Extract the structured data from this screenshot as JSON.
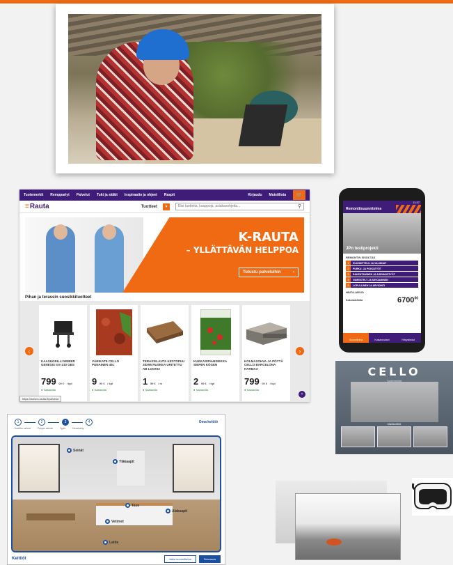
{
  "site": {
    "nav": [
      "Tuotemerkit",
      "Remppariyt",
      "Palvelut",
      "Tukt ja säläit",
      "Inspiraatio ja ohjeet",
      "Raspit"
    ],
    "nav_right": [
      "Kirjaudu",
      "Muistilista"
    ],
    "logo": "Rauta",
    "products_label": "Tuotteet",
    "search_placeholder": "Etsi tuotteita, kauppoja, asiakasohjeita...",
    "hero_title": "K-RAUTA",
    "hero_subtitle": "– YLLÄTTÄVÄN HELPPOA",
    "hero_button": "Tutustu palveluihin",
    "section_title": "Pihan ja terassin suosikkituotteet",
    "status_url": "https://www.k-rauta.fi/palvelut",
    "products": [
      {
        "name": "KAASUGRILLI WEBER GENESIS II E-210 GBS",
        "price": "799",
        "cents": "00 €",
        "unit": "/ kpl",
        "stock": "Saatavilla"
      },
      {
        "name": "VÄRIKATE CELLO PUNAINEN 45L",
        "price": "9",
        "cents": "90 €",
        "unit": "/ kpl",
        "stock": "Saatavilla"
      },
      {
        "name": "TERASSILAUTA KESTOPUU 28X95 RUSKEA URITETTU AB LOOKIA",
        "price": "1",
        "cents": "59 €",
        "unit": "/ m",
        "stock": "Saatavilla"
      },
      {
        "name": "KUKKASIPIANSIEKKA SIEPEN KÖGEN",
        "price": "2",
        "cents": "95 €",
        "unit": "/ kpl",
        "stock": "Saatavilla"
      },
      {
        "name": "KOLMASOHVA JA PÖYTÄ CELLO BARCELONA HARMAA",
        "price": "799",
        "cents": "00 €",
        "unit": "/ kpl",
        "stock": "Saatavilla"
      }
    ]
  },
  "phone": {
    "time": "11:37",
    "title": "Remonttisuunnitelma",
    "project": "JPn testiprojekti",
    "section": "REMONTIN SISÄLTÄÄ",
    "items": [
      {
        "num": "1",
        "label": "SUUNNITTELU JA VALINNAT"
      },
      {
        "num": "2",
        "label": "PURKU- JA POHJATYÖT"
      },
      {
        "num": "3",
        "label": "RAKENTAMINEN JA ASENNUSTYÖT"
      },
      {
        "num": "4",
        "label": "VIIMEISTELY JA SIIVOAMINEN"
      },
      {
        "num": "5",
        "label": "LOPULLINEN JA ARVIOINTI"
      }
    ],
    "price_section": "HINTA-ARVIO",
    "price_label": "Kokonaishinta",
    "price": "6700",
    "price_suffix": "00",
    "tabs": [
      "Suunnitelma",
      "Kustannukset",
      "Yhteystiedot"
    ]
  },
  "cello": {
    "logo": "CELLO",
    "subtitle": "Tuotemerkki",
    "mid_label": "Mallikeittiöt"
  },
  "planner": {
    "steps": [
      "1",
      "2",
      "3",
      "4"
    ],
    "active_step": 3,
    "step_names": [
      "Keittiön valinta",
      "Pohjan valinta",
      "Tyylit",
      "Viimeistely"
    ],
    "link": "Oma keittiö",
    "hotspots": [
      "Seinät",
      "Yläkaapit",
      "Taso",
      "Alakaapit",
      "Vetimet",
      "Lattia"
    ],
    "logo": "Keittiöt",
    "btn_secondary": "Jatka suunnittelua",
    "btn_primary": "Seuraava"
  }
}
